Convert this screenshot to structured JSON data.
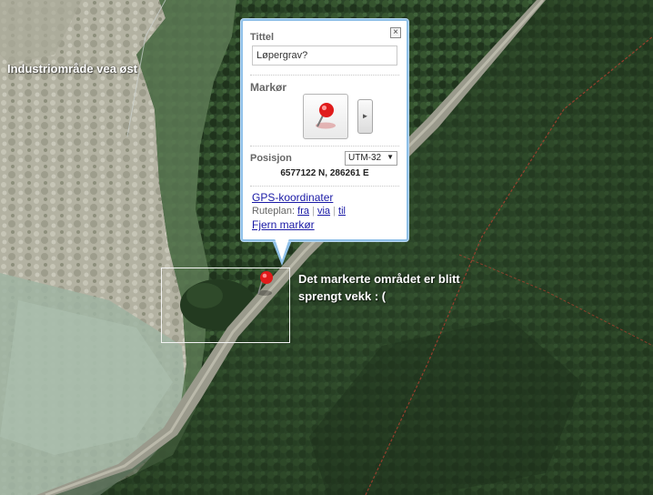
{
  "map": {
    "labels": {
      "industri": "Industriområde vea øst",
      "annotation": "Det markerte området er blitt sprengt vekk : ("
    }
  },
  "popup": {
    "title_label": "Tittel",
    "title_value": "Løpergrav?",
    "marker_label": "Markør",
    "position_label": "Posisjon",
    "projection_selected": "UTM-32",
    "coordinates": "6577122 N,  286261 E",
    "gps_link": "GPS-koordinater",
    "ruteplan_label": "Ruteplan:",
    "route_from": "fra",
    "route_via": "via",
    "route_to": "til",
    "remove_link": "Fjern markør",
    "close_icon": "close-icon"
  },
  "colors": {
    "popup_border": "#8fc0e8",
    "link": "#1a1aa6",
    "marker_red": "#e01b1b"
  }
}
